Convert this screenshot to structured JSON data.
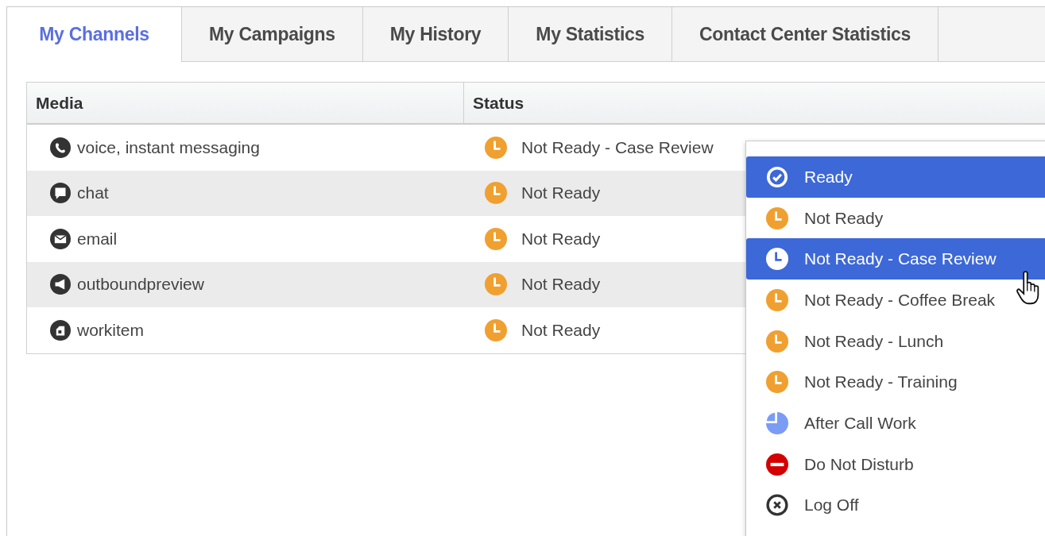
{
  "tabs": [
    {
      "label": "My Channels",
      "selected": true
    },
    {
      "label": "My Campaigns",
      "selected": false
    },
    {
      "label": "My History",
      "selected": false
    },
    {
      "label": "My Statistics",
      "selected": false
    },
    {
      "label": "Contact Center Statistics",
      "selected": false
    }
  ],
  "table": {
    "columns": [
      "Media",
      "Status"
    ],
    "rows": [
      {
        "media": {
          "label": "voice, instant messaging",
          "kind": "voice"
        },
        "status": {
          "label": "Not Ready - Case Review",
          "kind": "not_ready"
        }
      },
      {
        "media": {
          "label": "chat",
          "kind": "chat"
        },
        "status": {
          "label": "Not Ready",
          "kind": "not_ready"
        }
      },
      {
        "media": {
          "label": "email",
          "kind": "email"
        },
        "status": {
          "label": "Not Ready",
          "kind": "not_ready"
        }
      },
      {
        "media": {
          "label": "outboundpreview",
          "kind": "outbound"
        },
        "status": {
          "label": "Not Ready",
          "kind": "not_ready"
        }
      },
      {
        "media": {
          "label": "workitem",
          "kind": "workitem"
        },
        "status": {
          "label": "Not Ready",
          "kind": "not_ready"
        }
      }
    ]
  },
  "status_menu": {
    "items": [
      {
        "label": "Ready",
        "kind": "ready",
        "highlighted": true
      },
      {
        "label": "Not Ready",
        "kind": "not_ready",
        "highlighted": false
      },
      {
        "label": "Not Ready - Case Review",
        "kind": "not_ready",
        "highlighted": true
      },
      {
        "label": "Not Ready - Coffee Break",
        "kind": "not_ready",
        "highlighted": false
      },
      {
        "label": "Not Ready - Lunch",
        "kind": "not_ready",
        "highlighted": false
      },
      {
        "label": "Not Ready - Training",
        "kind": "not_ready",
        "highlighted": false
      },
      {
        "label": "After Call Work",
        "kind": "after_call_work",
        "highlighted": false
      },
      {
        "label": "Do Not Disturb",
        "kind": "do_not_disturb",
        "highlighted": false
      },
      {
        "label": "Log Off",
        "kind": "log_off",
        "highlighted": false
      }
    ]
  }
}
